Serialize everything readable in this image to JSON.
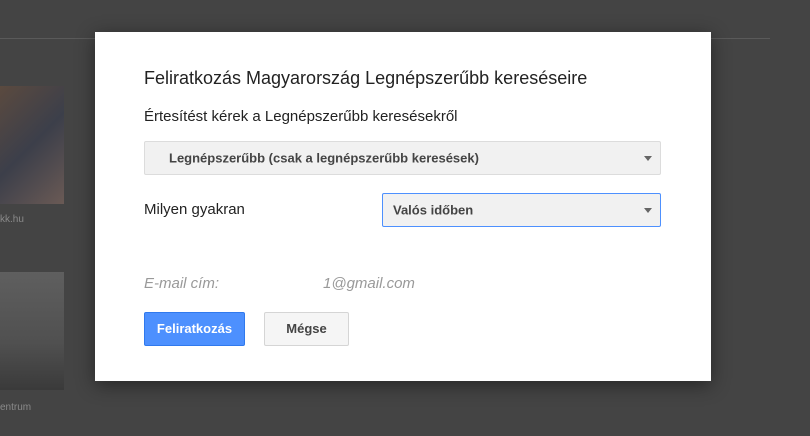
{
  "background": {
    "thumb1_caption": "kk.hu",
    "thumb2_caption": "entrum",
    "top_text": "..."
  },
  "dialog": {
    "title": "Feliratkozás Magyarország Legnépszerűbb kereséseire",
    "subtitle": "Értesítést kérek a Legnépszerűbb keresésekről",
    "type_select": "Legnépszerűbb (csak a legnépszerűbb keresések)",
    "frequency_label": "Milyen gyakran",
    "frequency_select": "Valós időben",
    "email_label": "E-mail cím:",
    "email_value": "1@gmail.com",
    "subscribe_button": "Feliratkozás",
    "cancel_button": "Mégse"
  },
  "colors": {
    "accent": "#4d90fe",
    "overlay": "#444444"
  }
}
